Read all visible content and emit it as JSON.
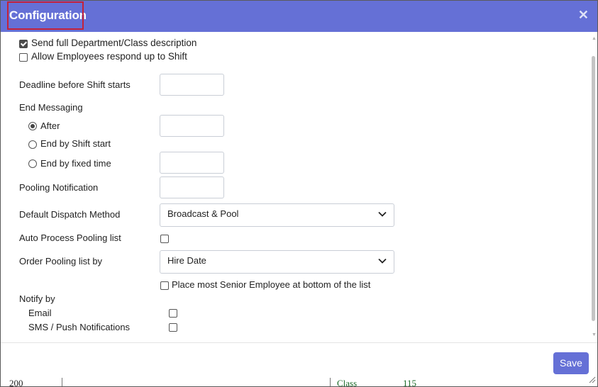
{
  "dialog": {
    "title": "Configuration",
    "close_glyph": "✕"
  },
  "options": {
    "send_full_description": {
      "label": "Send full Department/Class description",
      "checked": true
    },
    "allow_employees_respond": {
      "label": "Allow Employees respond up to Shift",
      "checked": false
    }
  },
  "deadline": {
    "label": "Deadline before Shift starts",
    "value": ""
  },
  "end_messaging": {
    "label": "End Messaging",
    "choices": [
      {
        "label": "After",
        "selected": true,
        "value": ""
      },
      {
        "label": "End by Shift start",
        "selected": false
      },
      {
        "label": "End by fixed time",
        "selected": false,
        "value": ""
      }
    ]
  },
  "pooling_notification": {
    "label": "Pooling Notification",
    "value": ""
  },
  "dispatch_method": {
    "label": "Default Dispatch Method",
    "selected": "Broadcast & Pool"
  },
  "auto_process": {
    "label": "Auto Process Pooling list",
    "checked": false
  },
  "order_by": {
    "label": "Order Pooling list by",
    "selected": "Hire Date"
  },
  "senior_bottom": {
    "label": "Place most Senior Employee at bottom of the list",
    "checked": false
  },
  "notify_by": {
    "label": "Notify by",
    "email": {
      "label": "Email",
      "checked": false
    },
    "sms": {
      "label": "SMS / Push Notifications",
      "checked": false
    }
  },
  "footer": {
    "save_label": "Save"
  },
  "background_fragments": {
    "left": "200",
    "class": "Class",
    "number": "115"
  },
  "icons": {
    "close": "close-icon",
    "chevron": "chevron-down-icon",
    "scroll_up": "scroll-up-arrow-icon",
    "scroll_down": "scroll-down-arrow-icon"
  },
  "colors": {
    "titlebar": "#6570d6",
    "save_button": "#6570d6",
    "highlight_box": "#c3223a"
  }
}
